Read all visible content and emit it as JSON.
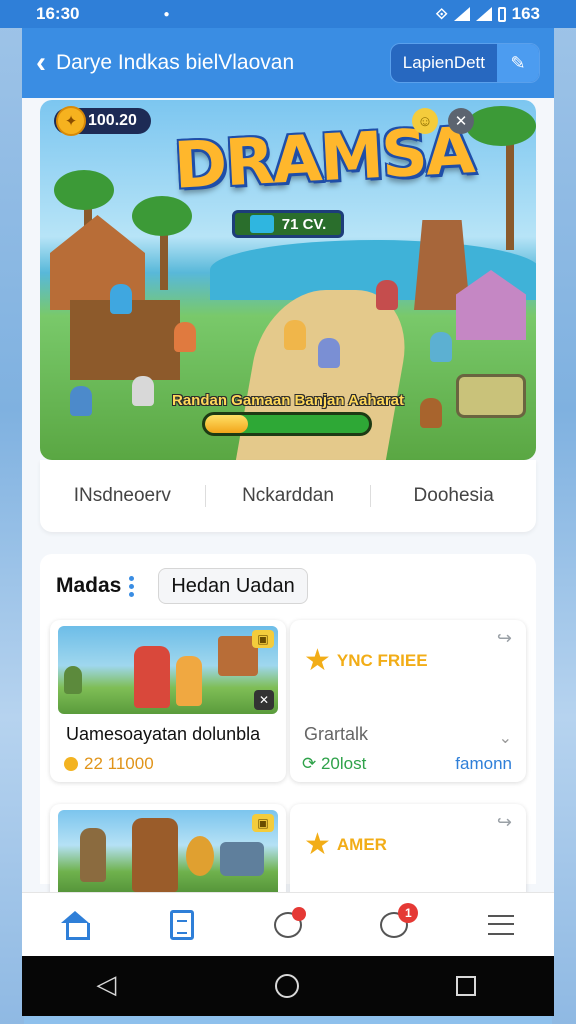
{
  "status_bar": {
    "time": "16:30",
    "signal_text": "163"
  },
  "app_bar": {
    "back_icon": "chevron-left-icon",
    "title": "Darye Indkas bielVlaovan",
    "action_label": "LapienDett",
    "action_icon": "edit-icon"
  },
  "hero": {
    "coin_amount": "100.20",
    "coin_icon_glyph": "✦",
    "game_logo": "DRAMSA",
    "logo_badge": "71 CV.",
    "loading_text": "Randan Gamaan Banjan Aaharat",
    "loading_progress": 0.26,
    "top_right_icons": [
      "smile-icon",
      "close-icon"
    ]
  },
  "tabs": [
    "INsdneoerv",
    "Nckarddan",
    "Doohesia"
  ],
  "section": {
    "title": "Madas",
    "chip_label": "Hedan Uadan",
    "cards": [
      {
        "title": "Uamesoayatan dolunbla",
        "price": "22 11000"
      },
      {
        "badge_text": "YNC FRIEE",
        "title": "Grartalk",
        "count": "20lost",
        "link": "famonn"
      },
      {
        "title": ""
      },
      {
        "badge_text": "AMER"
      }
    ]
  },
  "bottom_nav": {
    "items": [
      "home-icon",
      "document-icon",
      "chat-icon",
      "notifications-chat-icon",
      "menu-icon"
    ],
    "badge_count": "1"
  },
  "colors": {
    "primary": "#3a8de3",
    "accent_orange": "#f2ad17",
    "accent_green": "#33b04a"
  }
}
